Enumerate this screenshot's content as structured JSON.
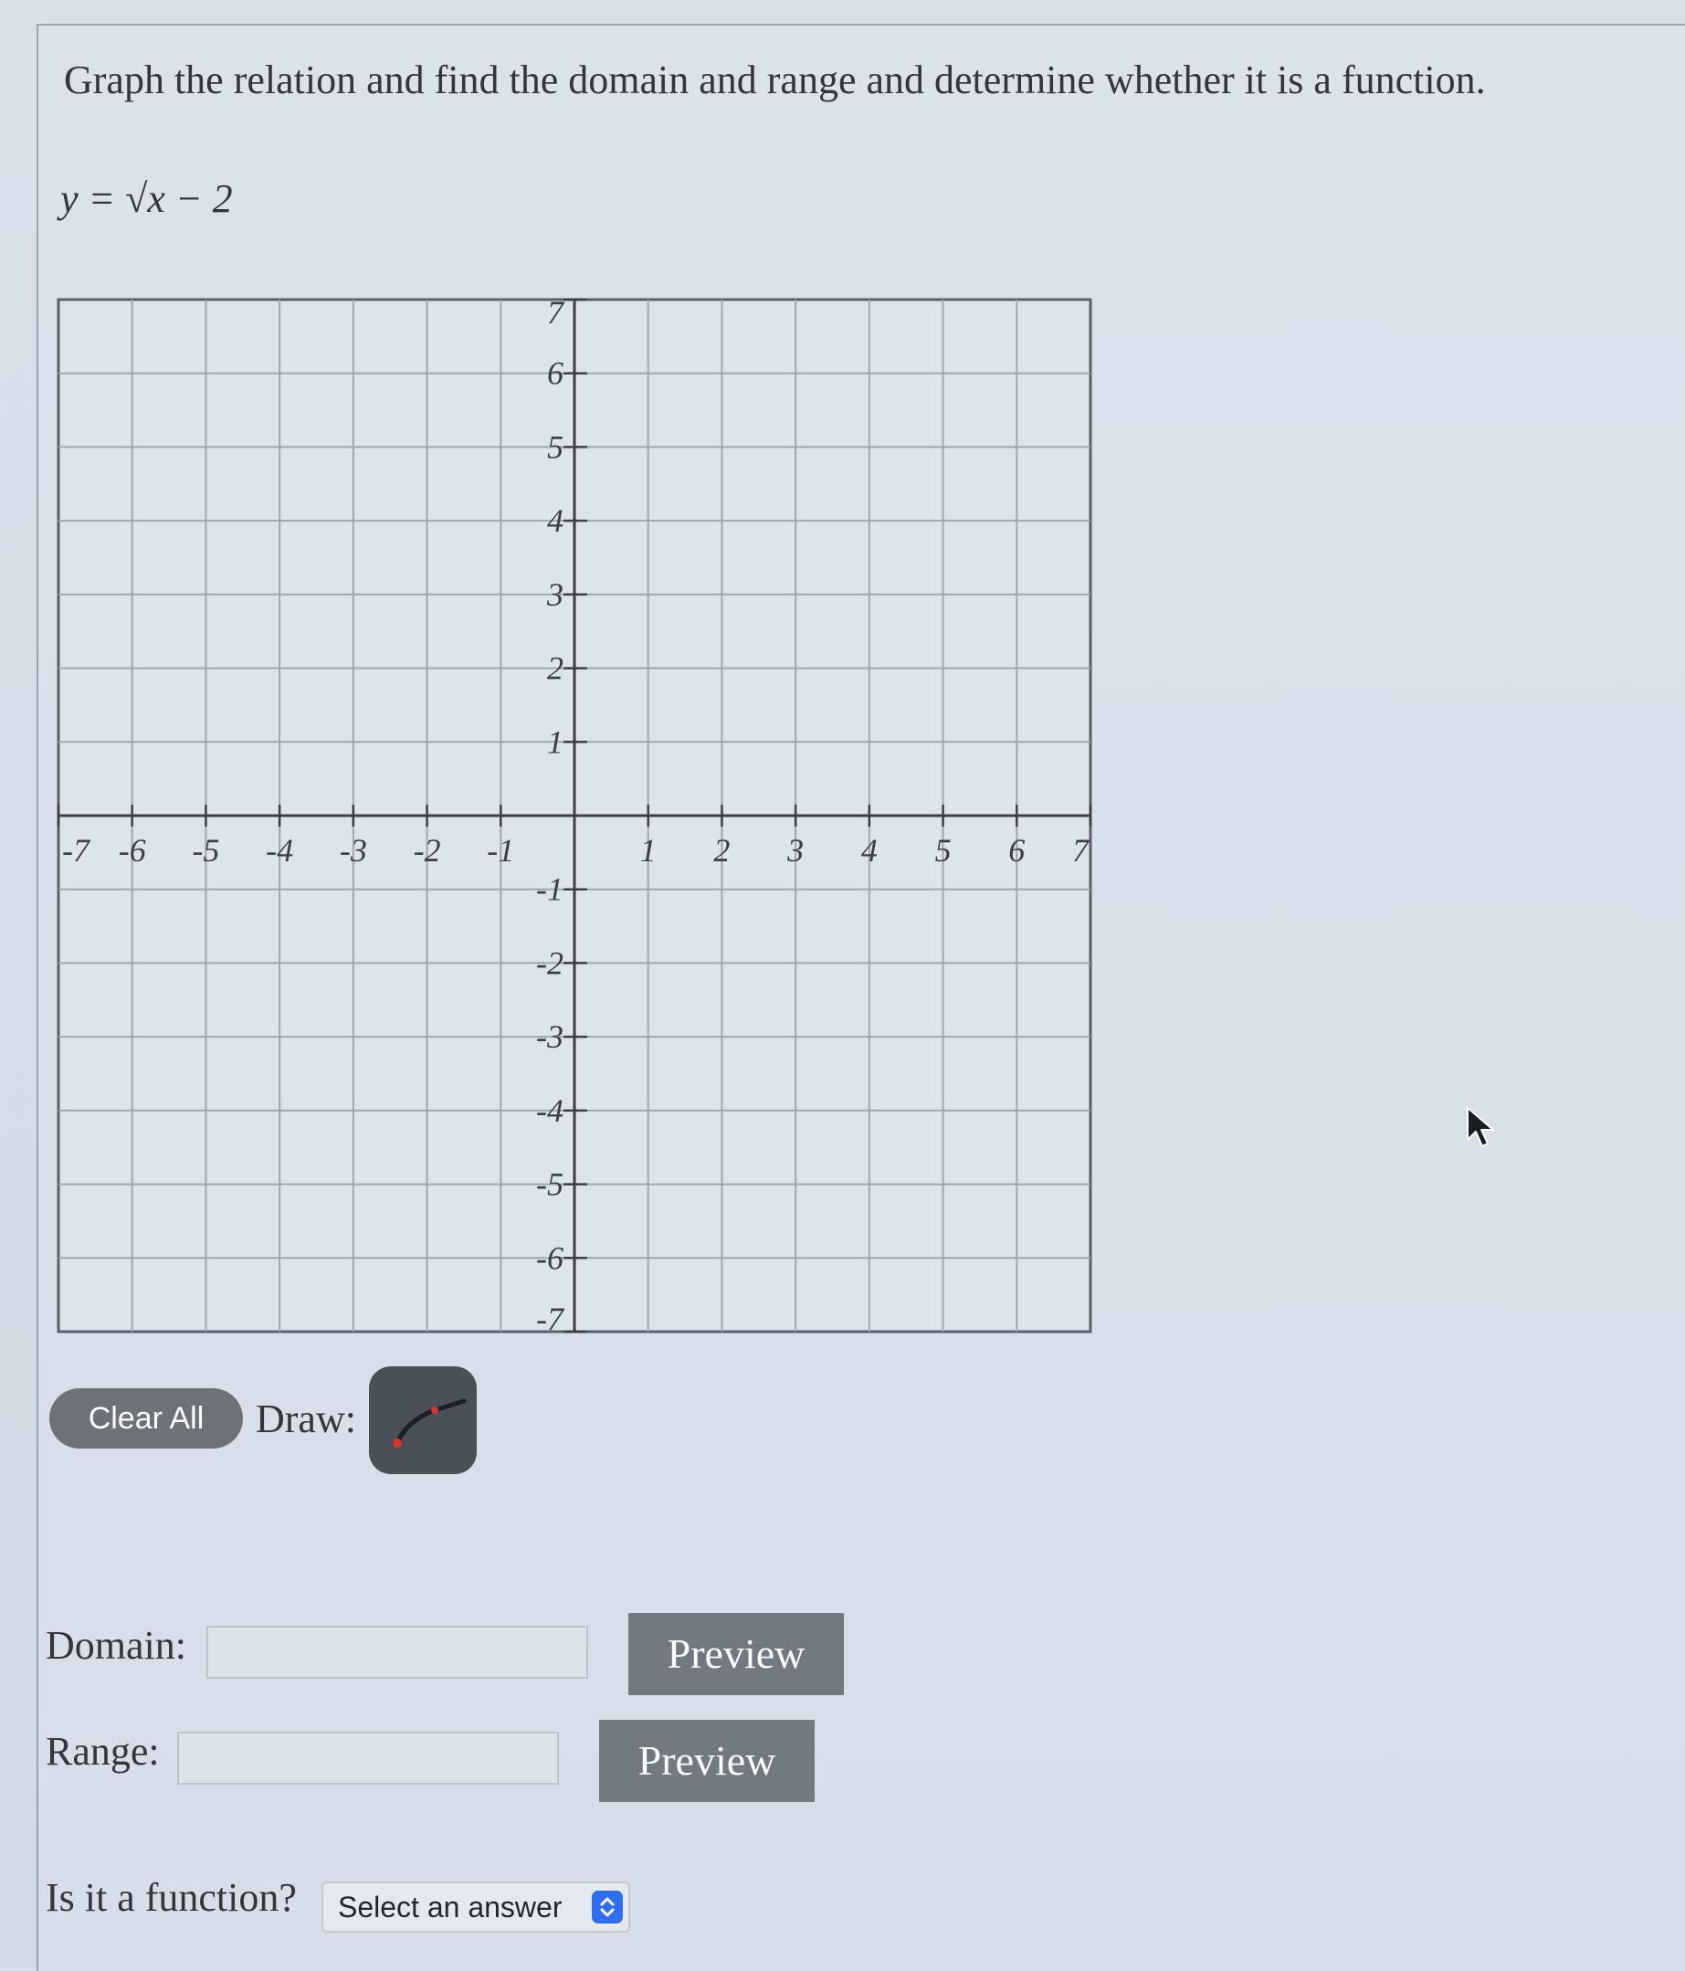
{
  "question": {
    "text": "Graph the relation and find the domain and range and determine whether it is a function.",
    "equation": "y = √x − 2"
  },
  "graph": {
    "x_min": -7,
    "x_max": 7,
    "y_min": -7,
    "y_max": 7,
    "x_tick_labels": [
      "-7",
      "-6",
      "-5",
      "-4",
      "-3",
      "-2",
      "-1",
      "1",
      "2",
      "3",
      "4",
      "5",
      "6",
      "7"
    ],
    "y_tick_labels": [
      "7",
      "6",
      "5",
      "4",
      "3",
      "2",
      "1",
      "-1",
      "-2",
      "-3",
      "-4",
      "-5",
      "-6",
      "-7"
    ],
    "grid_color": "#9ea6b0",
    "axis_color": "#3a3f46"
  },
  "tools": {
    "clear_all_label": "Clear All",
    "draw_label": "Draw:",
    "draw_tool_icon": "sqrt-curve-icon"
  },
  "domain": {
    "label": "Domain:",
    "value": "",
    "preview_label": "Preview"
  },
  "range": {
    "label": "Range:",
    "value": "",
    "preview_label": "Preview"
  },
  "function_question": {
    "label": "Is it a function?",
    "selected": "Select an answer"
  }
}
